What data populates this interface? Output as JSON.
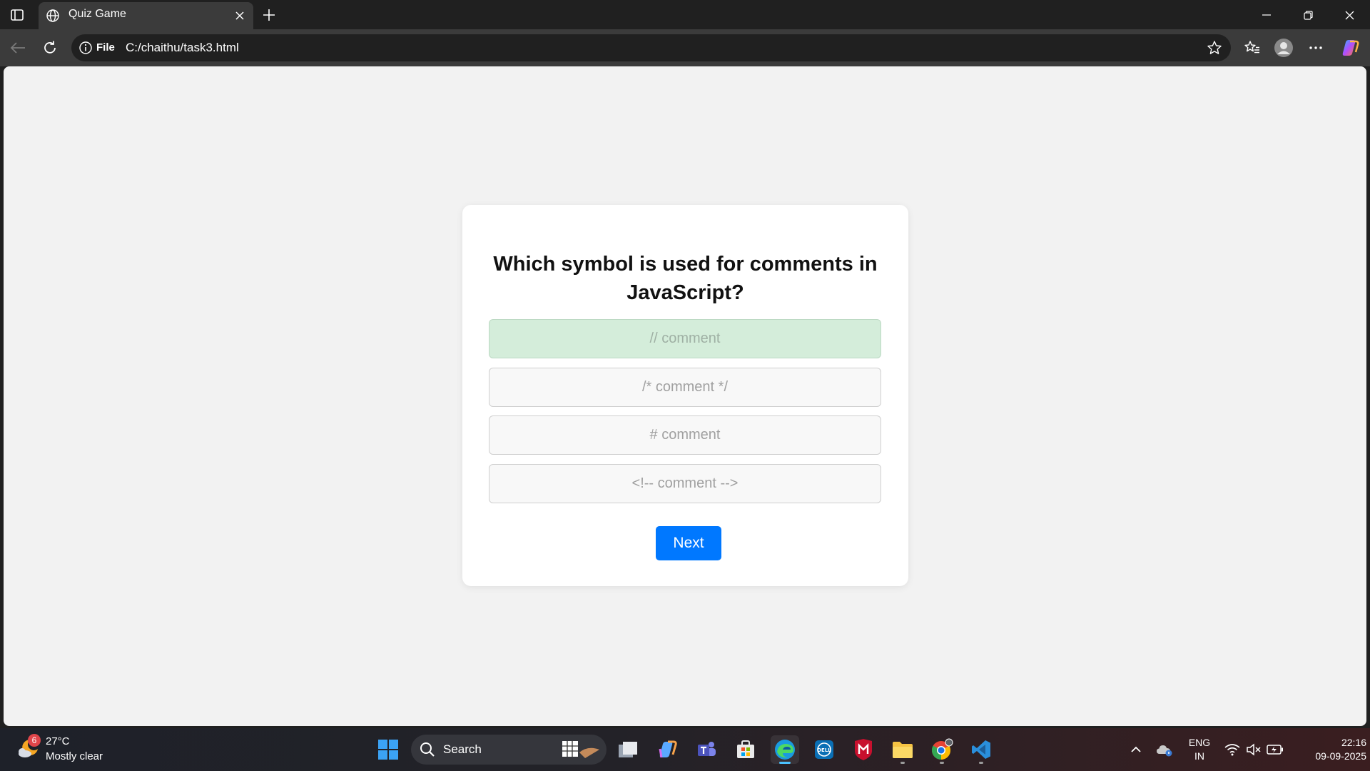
{
  "browser": {
    "tab_title": "Quiz Game",
    "omnibox": {
      "scheme_label": "File",
      "url": "C:/chaithu/task3.html"
    }
  },
  "quiz": {
    "question": "Which symbol is used for comments in JavaScript?",
    "options": [
      {
        "label": "// comment",
        "state": "correct"
      },
      {
        "label": "/* comment */",
        "state": "default"
      },
      {
        "label": "# comment",
        "state": "default"
      },
      {
        "label": "<!-- comment -->",
        "state": "default"
      }
    ],
    "next_label": "Next"
  },
  "taskbar": {
    "weather": {
      "badge": "6",
      "temperature": "27°C",
      "condition": "Mostly clear"
    },
    "search_label": "Search",
    "apps": [
      "task-view",
      "copilot",
      "teams",
      "microsoft-store",
      "edge",
      "dell",
      "mcafee",
      "file-explorer",
      "chrome",
      "vscode"
    ],
    "language": {
      "line1": "ENG",
      "line2": "IN"
    },
    "clock": {
      "time": "22:16",
      "date": "09-09-2025"
    }
  },
  "colors": {
    "accent": "#0078ff",
    "correct_bg": "#d4edda",
    "page_bg": "#f2f2f2"
  }
}
